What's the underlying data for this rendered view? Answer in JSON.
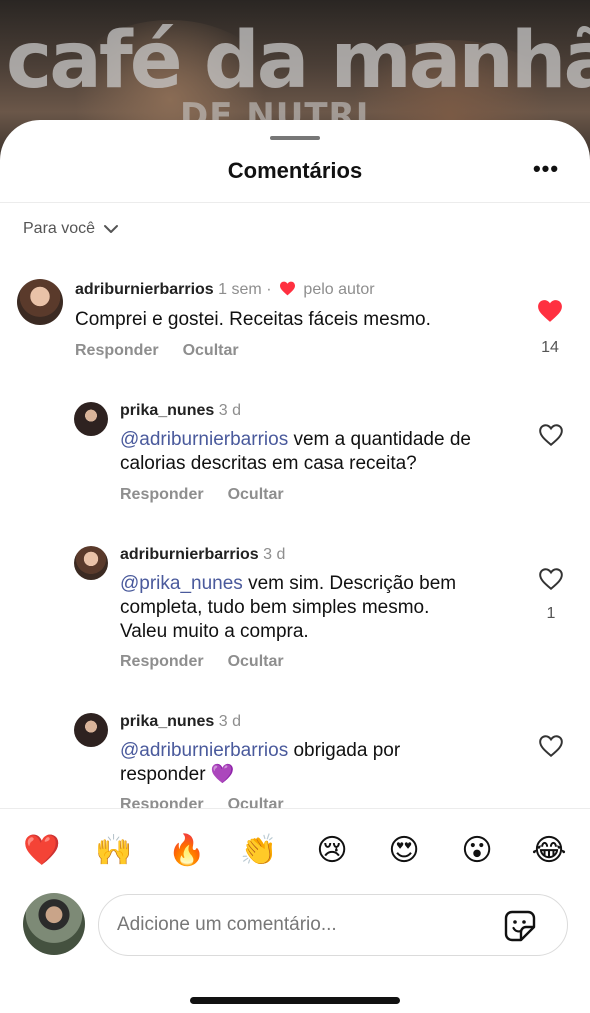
{
  "background": {
    "title": "café da manhã",
    "subtitle": "DE NUTRI"
  },
  "sheet": {
    "title": "Comentários",
    "more_icon": "more-horizontal-icon"
  },
  "filter": {
    "label": "Para você"
  },
  "comments": [
    {
      "username": "adriburnierbarrios",
      "time": "1 sem",
      "separator": "·",
      "liked_by_author": "pelo autor",
      "text": "Comprei e gostei. Receitas fáceis mesmo.",
      "reply": "Responder",
      "hide": "Ocultar",
      "liked": true,
      "like_count": "14"
    },
    {
      "username": "prika_nunes",
      "time": "3 d",
      "mention": "@adriburnierbarrios",
      "text": "vem a quantidade de",
      "text2": "calorias descritas em casa receita?",
      "reply": "Responder",
      "hide": "Ocultar",
      "liked": false
    },
    {
      "username": "adriburnierbarrios",
      "time": "3 d",
      "mention": "@prika_nunes",
      "text": "vem sim. Descrição bem",
      "text2": "completa, tudo bem simples mesmo.",
      "text3": "Valeu muito a compra.",
      "reply": "Responder",
      "hide": "Ocultar",
      "liked": false,
      "like_count": "1"
    },
    {
      "username": "prika_nunes",
      "time": "3 d",
      "mention": "@adriburnierbarrios",
      "text": "obrigada por",
      "text2": "responder 💜",
      "reply": "Responder",
      "hide": "Ocultar",
      "liked": false
    }
  ],
  "emoji_bar": [
    "❤️",
    "🙌",
    "🔥",
    "👏",
    "😢",
    "😍",
    "😮",
    "😂"
  ],
  "composer": {
    "placeholder": "Adicione um comentário...",
    "sticker_icon": "sticker-icon"
  },
  "colors": {
    "like_red": "#ff3040",
    "mention": "#4a5a9c",
    "muted": "#8e8e8e"
  }
}
